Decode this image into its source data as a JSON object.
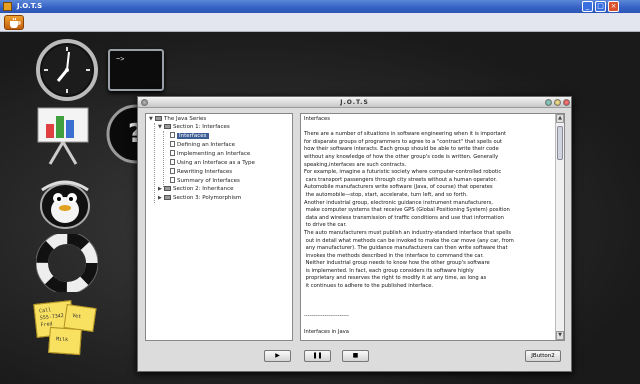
{
  "window": {
    "title": "J.O.T.S"
  },
  "app": {
    "title": "J.O.T.S"
  },
  "desktop": {
    "terminal_prompt": "~>",
    "notes_text": [
      "Call",
      "555-7342",
      "Fred",
      "Milk",
      "Vet"
    ]
  },
  "tree": {
    "root": "The Java Series",
    "section1": "Section 1: Interfaces",
    "items": [
      "Interfaces",
      "Defining an Interface",
      "Implementing an Interface",
      "Using an Interface as a Type",
      "Rewriting Interfaces",
      "Summary of Interfaces"
    ],
    "section2": "Section 2: Inheritance",
    "section3": "Section 3: Polymorphism"
  },
  "content": {
    "text": "Interfaces\n\nThere are a number of situations in software engineering when it is important\nfor disparate groups of programmers to agree to a \"contract\" that spells out\nhow their software interacts. Each group should be able to write their code\nwithout any knowledge of how the other group's code is written. Generally\nspeaking,interfaces are such contracts.\nFor example, imagine a futuristic society where computer-controlled robotic\n cars transport passengers through city streets without a human operator.\nAutomobile manufacturers write software (Java, of course) that operates\n the automobile—stop, start, accelerate, turn left, and so forth.\nAnother industrial group, electronic guidance instrument manufacturers,\n make computer systems that receive GPS (Global Positioning System) position\n data and wireless transmission of traffic conditions and use that information\n to drive the car.\nThe auto manufacturers must publish an industry-standard interface that spells\n out in detail what methods can be invoked to make the car move (any car, from\n any manufacturer). The guidance manufacturers can then write software that\n invokes the methods described in the interface to command the car.\n Neither industrial group needs to know how the other group's software\n is implemented. In fact, each group considers its software highly\n proprietary and reserves the right to modify it at any time, as long as\n it continues to adhere to the published interface.\n\n\n\n------------------------\n\nInterfaces in Java"
  },
  "controls": {
    "play": "▶",
    "pause": "❚❚",
    "stop": "■",
    "jbutton": "JButton2"
  }
}
